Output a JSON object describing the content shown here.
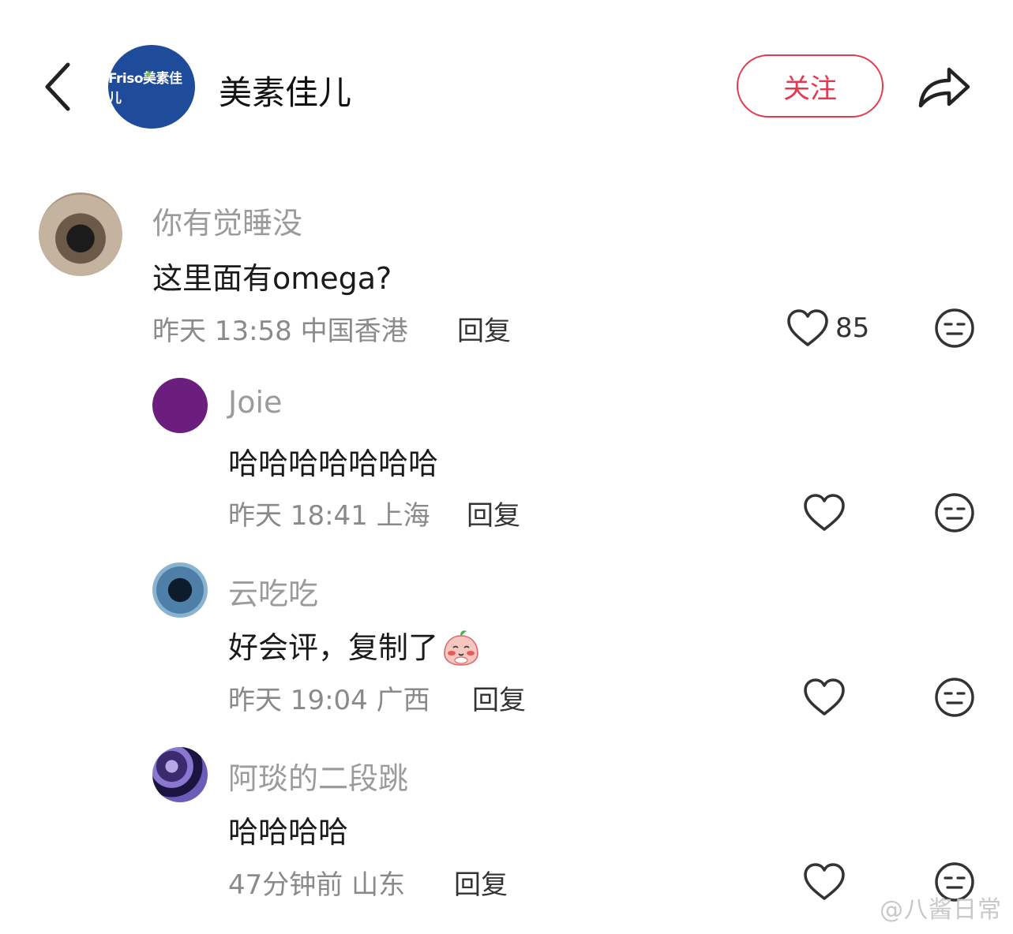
{
  "header": {
    "back_icon": "chevron-left-icon",
    "brand_logo_text": "Friso美素佳儿",
    "brand_name": "美素佳儿",
    "follow_label": "关注",
    "share_icon": "share-arrow-icon",
    "accent_color": "#e4394f"
  },
  "comments": [
    {
      "username": "你有觉睡没",
      "content": "这里面有omega?",
      "time": "昨天 13:58",
      "location": "中国香港",
      "reply_label": "回复",
      "likes": "85"
    },
    {
      "username": "Joie",
      "content": "哈哈哈哈哈哈哈",
      "time": "昨天 18:41",
      "location": "上海",
      "reply_label": "回复"
    },
    {
      "username": "云吃吃",
      "content": "好会评，复制了",
      "time": "昨天 19:04",
      "location": "广西",
      "reply_label": "回复"
    },
    {
      "username": "阿琰的二段跳",
      "content": "哈哈哈哈",
      "time": "47分钟前",
      "location": "山东",
      "reply_label": "回复"
    }
  ],
  "watermark": "@八酱日常"
}
